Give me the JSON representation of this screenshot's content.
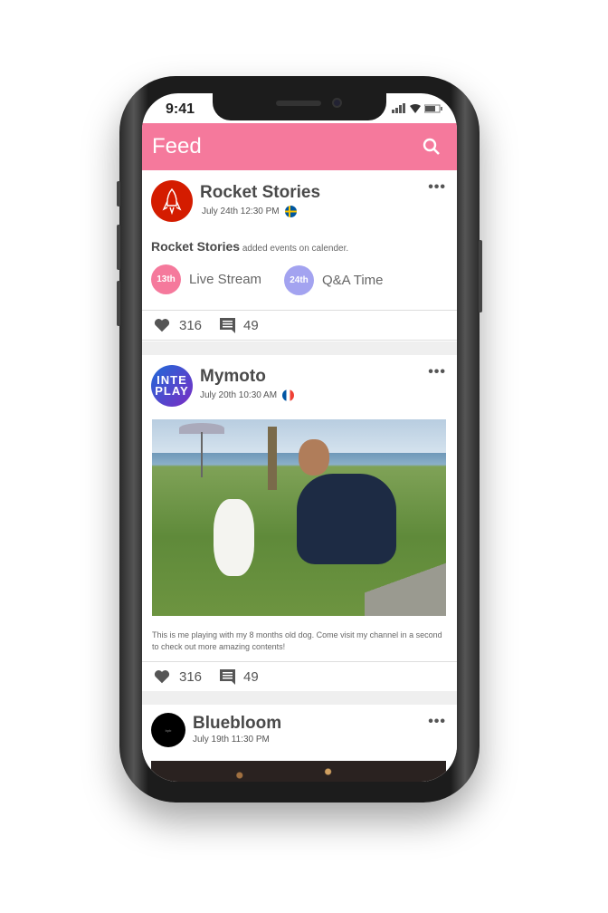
{
  "status_bar": {
    "time": "9:41"
  },
  "header": {
    "title": "Feed",
    "search_icon": "search-icon"
  },
  "posts": [
    {
      "author": "Rocket Stories",
      "date": "July 24th 12:30 PM",
      "flag": "sweden",
      "activity_author": "Rocket Stories",
      "activity_text": "added events on calender.",
      "events": [
        {
          "day": "13th",
          "label": "Live Stream",
          "color": "#f5799c"
        },
        {
          "day": "24th",
          "label": "Q&A Time",
          "color": "#a3a3f0"
        }
      ],
      "likes": "316",
      "comments": "49"
    },
    {
      "author": "Mymoto",
      "avatar_logo": "INTER PLAY",
      "date": "July 20th 10:30 AM",
      "flag": "france",
      "caption": "This is me playing with my 8 months old dog. Come visit my channel in a second to check out more amazing contents!",
      "likes": "316",
      "comments": "49"
    },
    {
      "author": "Bluebloom",
      "avatar_logo": "bpb",
      "date": "July 19th 11:30 PM"
    }
  ],
  "colors": {
    "accent": "#f5799c",
    "event2": "#a3a3f0"
  }
}
